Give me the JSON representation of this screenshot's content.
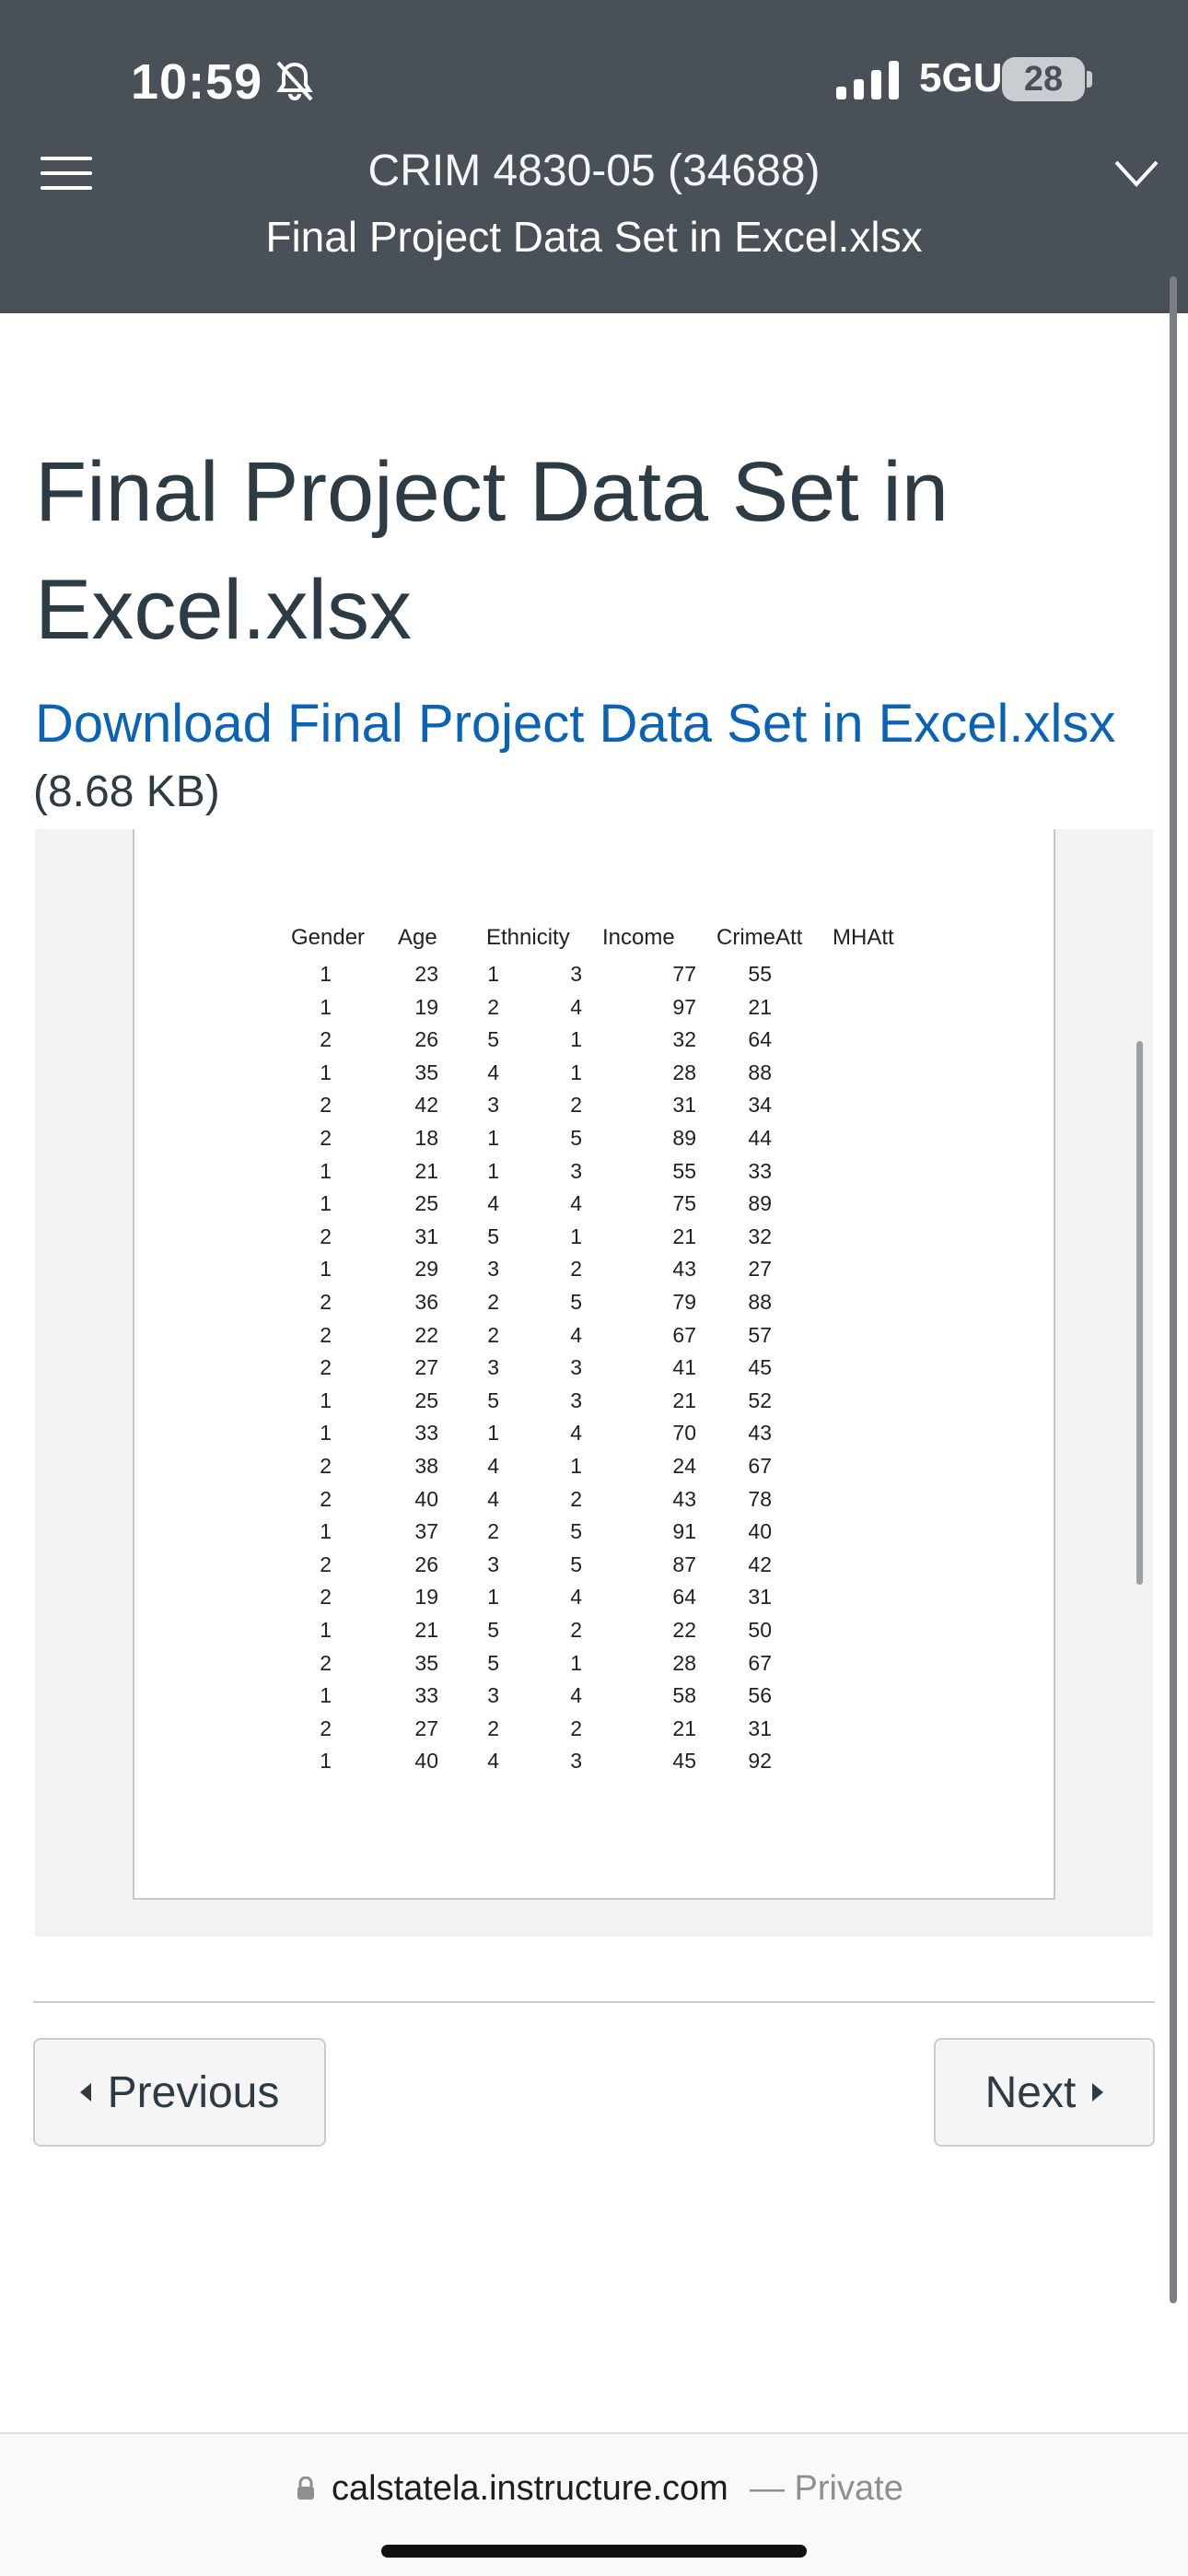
{
  "status_bar": {
    "time": "10:59",
    "network": "5GUC",
    "battery": "28"
  },
  "header": {
    "course": "CRIM 4830-05 (34688)",
    "file_title": "Final Project Data Set in Excel.xlsx"
  },
  "main": {
    "page_title": "Final Project Data Set in Excel.xlsx",
    "download_link": "Download Final Project Data Set in Excel.xlsx",
    "file_size": "(8.68 KB)"
  },
  "spreadsheet": {
    "headers": [
      "Gender",
      "Age",
      "Ethnicity",
      "Income",
      "CrimeAtt",
      "MHAtt"
    ],
    "rows": [
      [
        "1",
        "23",
        "1",
        "3",
        "77",
        "55"
      ],
      [
        "1",
        "19",
        "2",
        "4",
        "97",
        "21"
      ],
      [
        "2",
        "26",
        "5",
        "1",
        "32",
        "64"
      ],
      [
        "1",
        "35",
        "4",
        "1",
        "28",
        "88"
      ],
      [
        "2",
        "42",
        "3",
        "2",
        "31",
        "34"
      ],
      [
        "2",
        "18",
        "1",
        "5",
        "89",
        "44"
      ],
      [
        "1",
        "21",
        "1",
        "3",
        "55",
        "33"
      ],
      [
        "1",
        "25",
        "4",
        "4",
        "75",
        "89"
      ],
      [
        "2",
        "31",
        "5",
        "1",
        "21",
        "32"
      ],
      [
        "1",
        "29",
        "3",
        "2",
        "43",
        "27"
      ],
      [
        "2",
        "36",
        "2",
        "5",
        "79",
        "88"
      ],
      [
        "2",
        "22",
        "2",
        "4",
        "67",
        "57"
      ],
      [
        "2",
        "27",
        "3",
        "3",
        "41",
        "45"
      ],
      [
        "1",
        "25",
        "5",
        "3",
        "21",
        "52"
      ],
      [
        "1",
        "33",
        "1",
        "4",
        "70",
        "43"
      ],
      [
        "2",
        "38",
        "4",
        "1",
        "24",
        "67"
      ],
      [
        "2",
        "40",
        "4",
        "2",
        "43",
        "78"
      ],
      [
        "1",
        "37",
        "2",
        "5",
        "91",
        "40"
      ],
      [
        "2",
        "26",
        "3",
        "5",
        "87",
        "42"
      ],
      [
        "2",
        "19",
        "1",
        "4",
        "64",
        "31"
      ],
      [
        "1",
        "21",
        "5",
        "2",
        "22",
        "50"
      ],
      [
        "2",
        "35",
        "5",
        "1",
        "28",
        "67"
      ],
      [
        "1",
        "33",
        "3",
        "4",
        "58",
        "56"
      ],
      [
        "2",
        "27",
        "2",
        "2",
        "21",
        "31"
      ],
      [
        "1",
        "40",
        "4",
        "3",
        "45",
        "92"
      ]
    ]
  },
  "nav": {
    "previous": "Previous",
    "next": "Next"
  },
  "browser": {
    "url": "calstatela.instructure.com",
    "privacy": "— Private"
  }
}
